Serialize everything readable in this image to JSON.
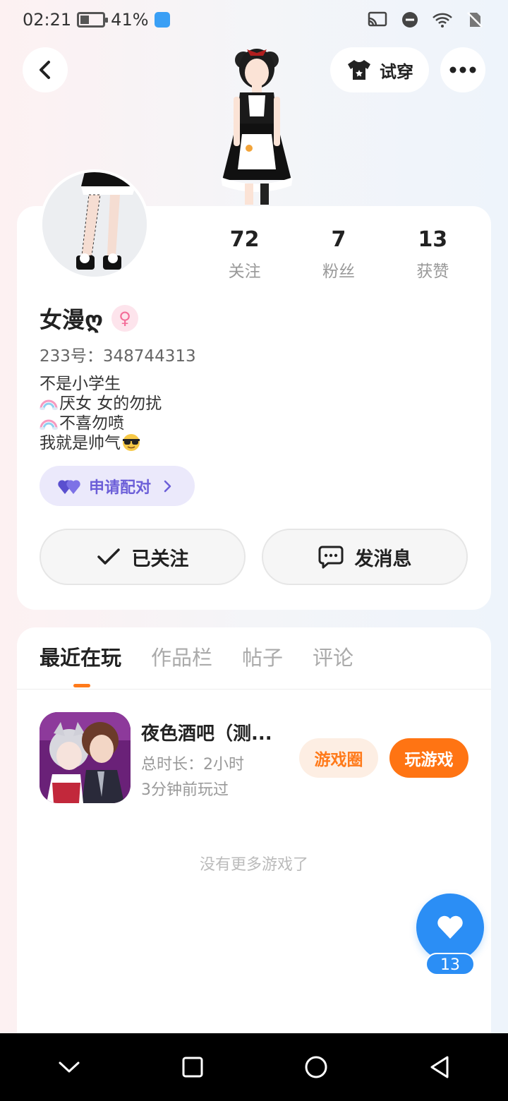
{
  "status_bar": {
    "time": "02:21",
    "battery_percent": "41%",
    "battery_level": 0.41
  },
  "header": {
    "back_icon": "chevron-left-icon",
    "try_on_label": "试穿",
    "try_on_icon": "tshirt-icon",
    "more_icon": "more-dots-icon"
  },
  "profile": {
    "name": "女漫ღ",
    "gender_icon": "female-icon",
    "uid": "233号：348744313",
    "bio_lines": [
      "不是小学生",
      "厌女 女的勿扰",
      "不喜勿喷",
      "我就是帅气"
    ],
    "stats": [
      {
        "value": "72",
        "label": "关注"
      },
      {
        "value": "7",
        "label": "粉丝"
      },
      {
        "value": "13",
        "label": "获赞"
      }
    ],
    "pair_label": "申请配对",
    "followed_label": "已关注",
    "message_label": "发消息"
  },
  "tabs": [
    "最近在玩",
    "作品栏",
    "帖子",
    "评论"
  ],
  "recent_game": {
    "title": "夜色酒吧（测...",
    "duration": "总时长：2小时",
    "last_played": "3分钟前玩过",
    "circle_label": "游戏圈",
    "play_label": "玩游戏"
  },
  "no_more_text": "没有更多游戏了",
  "likes": {
    "icon": "heart-icon",
    "count": "13"
  },
  "colors": {
    "accent_orange": "#ff7413",
    "accent_blue": "#2b8ef5",
    "pair_purple": "#6c5fd8"
  }
}
